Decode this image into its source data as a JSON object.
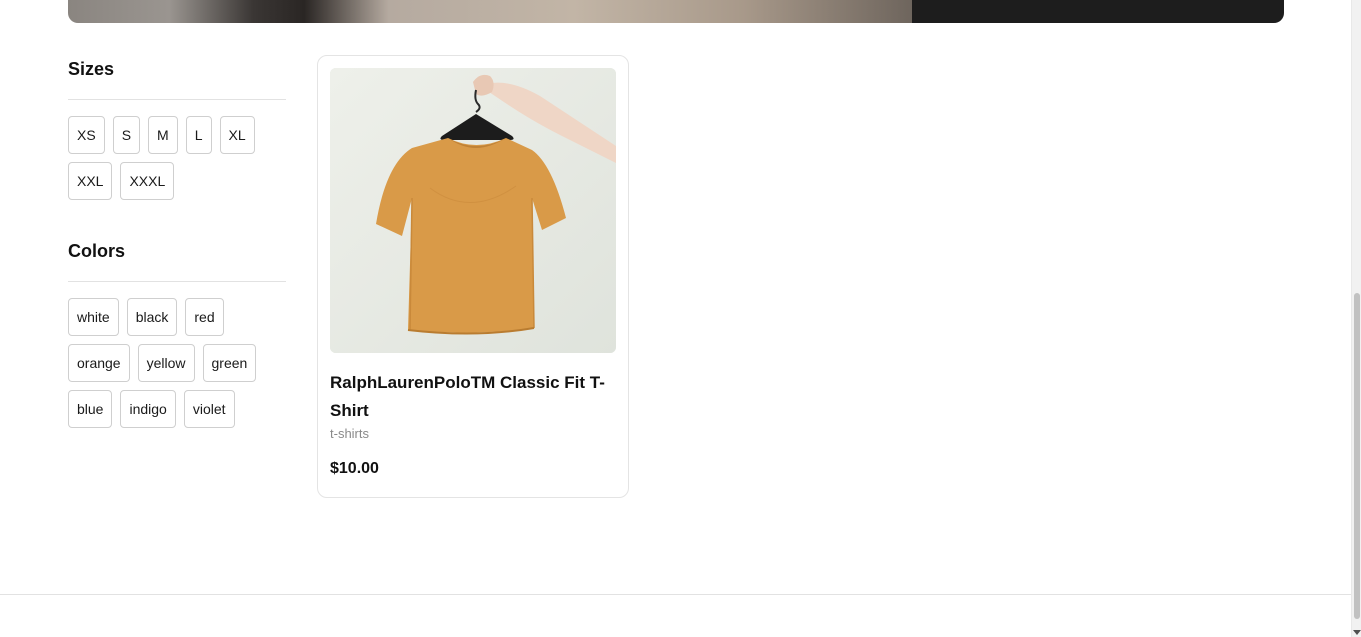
{
  "filters": {
    "sizes": {
      "title": "Sizes",
      "options": [
        "XS",
        "S",
        "M",
        "L",
        "XL",
        "XXL",
        "XXXL"
      ]
    },
    "colors": {
      "title": "Colors",
      "options": [
        "white",
        "black",
        "red",
        "orange",
        "yellow",
        "green",
        "blue",
        "indigo",
        "violet"
      ]
    }
  },
  "product": {
    "name": "RalphLaurenPoloTM Classic Fit T-Shirt",
    "category": "t-shirts",
    "price": "$10.00",
    "image_subject": "mustard-t-shirt-on-hanger"
  },
  "colors_theme": {
    "hero_panel": "#1d1d1d",
    "shirt": "#d99a48",
    "image_background": "#e9ece6"
  }
}
